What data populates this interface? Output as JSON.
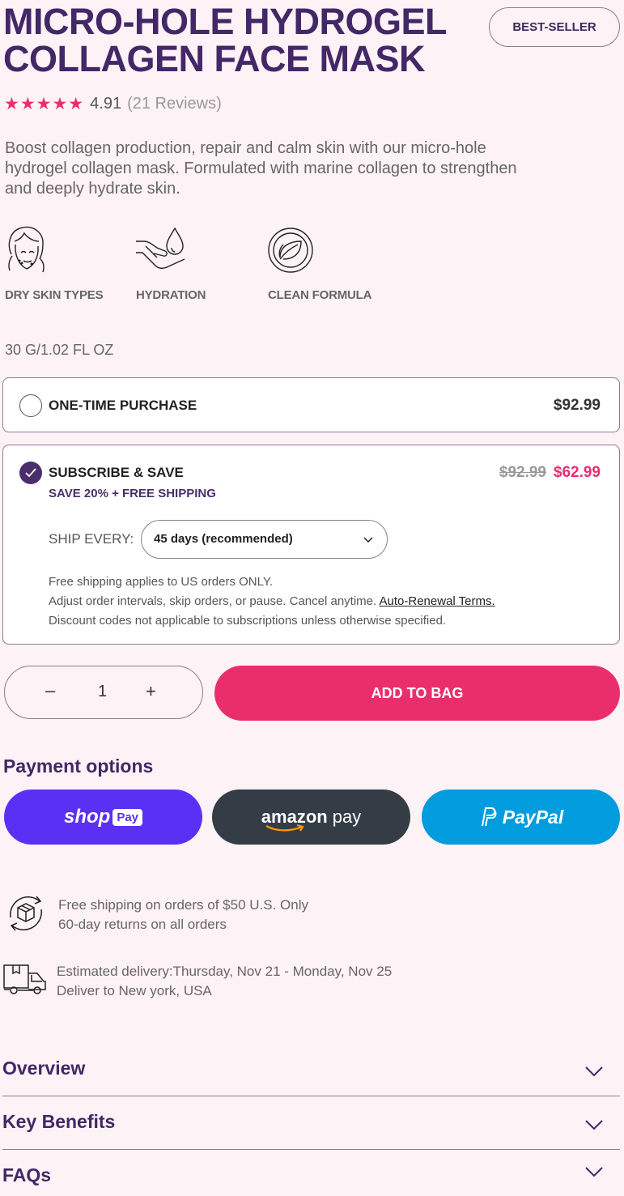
{
  "product": {
    "title": "MICRO-HOLE HYDROGEL COLLAGEN FACE MASK",
    "badge": "BEST-SELLER",
    "stars": "★★★★★",
    "rating": "4.91",
    "reviews": "(21 Reviews)",
    "description": "Boost collagen production, repair and calm skin with our micro-hole hydrogel collagen mask. Formulated with marine collagen to strengthen and deeply hydrate skin.",
    "size": "30 G/1.02 FL OZ"
  },
  "features": [
    {
      "label": "DRY SKIN TYPES",
      "icon": "face-icon"
    },
    {
      "label": "HYDRATION",
      "icon": "hand-drop-icon"
    },
    {
      "label": "CLEAN FORMULA",
      "icon": "leaf-badge-icon"
    }
  ],
  "purchase": {
    "one_time_label": "ONE-TIME PURCHASE",
    "one_time_price": "$92.99",
    "subscribe_label": "SUBSCRIBE & SAVE",
    "save_line": "SAVE 20% + FREE SHIPPING",
    "old_price": "$92.99",
    "new_price": "$62.99",
    "ship_every_label": "SHIP EVERY:",
    "ship_every_value": "45 days (recommended)",
    "note1": "Free shipping applies to US orders ONLY.",
    "note2": "Adjust order intervals, skip orders, or pause. Cancel anytime.",
    "note2_link": "Auto-Renewal Terms.",
    "note3": "Discount codes not applicable to subscriptions unless otherwise specified."
  },
  "cart": {
    "minus": "–",
    "quantity": "1",
    "plus": "+",
    "add_label": "ADD TO BAG"
  },
  "payment": {
    "title": "Payment options",
    "shop_text": "shop",
    "shop_pay": "Pay",
    "amazon_text": "amazon",
    "amazon_pay": "pay",
    "paypal_text": "PayPal"
  },
  "shipping": {
    "line1": "Free shipping on orders of $50 U.S. Only",
    "line2": "60-day returns on all orders",
    "line3": "Estimated delivery:Thursday, Nov 21 - Monday, Nov 25",
    "line4": "Deliver to New york, USA"
  },
  "accordion": [
    "Overview",
    "Key Benefits",
    "FAQs"
  ],
  "colors": {
    "accent": "#ea2e6c",
    "brand": "#432766",
    "background": "#fdf2f6"
  }
}
